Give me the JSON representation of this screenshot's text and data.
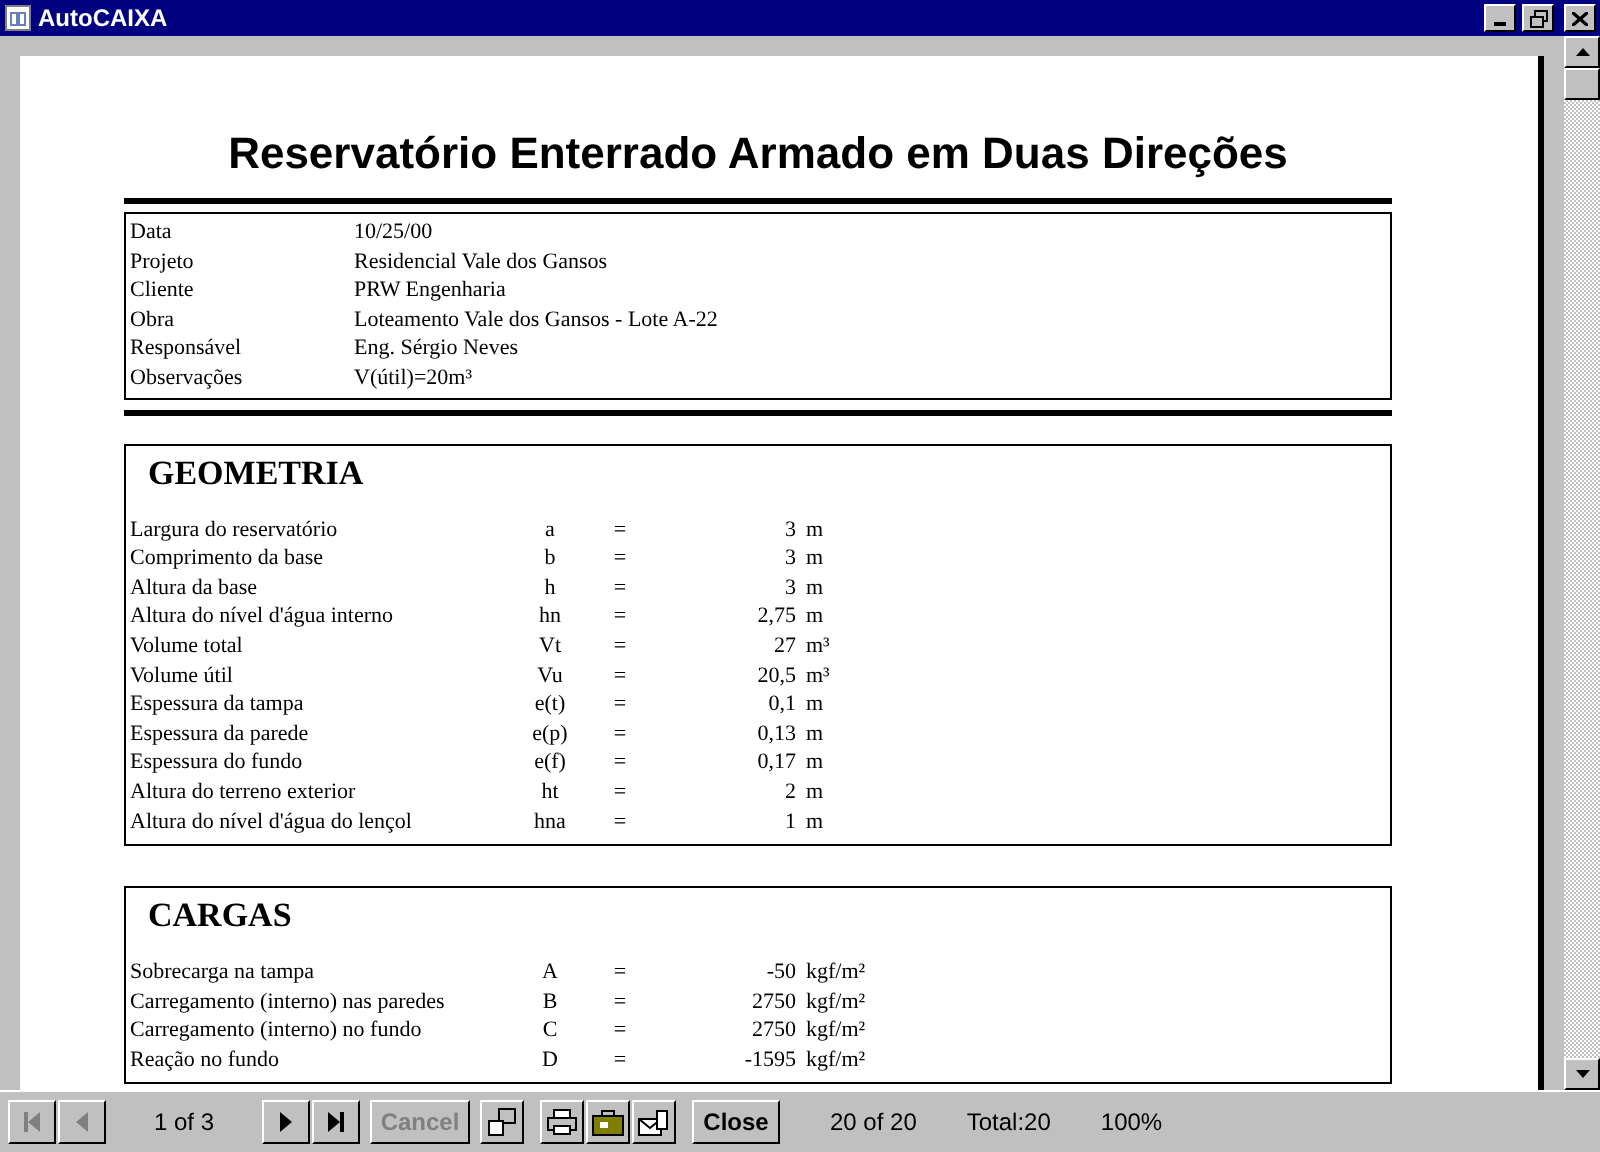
{
  "window": {
    "title": "AutoCAIXA"
  },
  "report": {
    "title": "Reservatório Enterrado Armado em Duas Direções",
    "info": [
      {
        "label": "Data",
        "value": "10/25/00"
      },
      {
        "label": "Projeto",
        "value": "Residencial Vale dos Gansos"
      },
      {
        "label": "Cliente",
        "value": "PRW Engenharia"
      },
      {
        "label": "Obra",
        "value": "Loteamento Vale dos Gansos - Lote A-22"
      },
      {
        "label": "Responsável",
        "value": "Eng. Sérgio Neves"
      },
      {
        "label": "Observações",
        "value": "V(útil)=20m³"
      }
    ],
    "sections": [
      {
        "heading": "GEOMETRIA",
        "rows": [
          {
            "label": "Largura do reservatório",
            "symbol": "a",
            "equals": "=",
            "value": "3",
            "unit": "m"
          },
          {
            "label": "Comprimento da base",
            "symbol": "b",
            "equals": "=",
            "value": "3",
            "unit": "m"
          },
          {
            "label": "Altura da base",
            "symbol": "h",
            "equals": "=",
            "value": "3",
            "unit": "m"
          },
          {
            "label": "Altura do nível d'água interno",
            "symbol": "hn",
            "equals": "=",
            "value": "2,75",
            "unit": "m"
          },
          {
            "label": "Volume total",
            "symbol": "Vt",
            "equals": "=",
            "value": "27",
            "unit": "m³"
          },
          {
            "label": "Volume útil",
            "symbol": "Vu",
            "equals": "=",
            "value": "20,5",
            "unit": "m³"
          },
          {
            "label": "Espessura da tampa",
            "symbol": "e(t)",
            "equals": "=",
            "value": "0,1",
            "unit": "m"
          },
          {
            "label": "Espessura da parede",
            "symbol": "e(p)",
            "equals": "=",
            "value": "0,13",
            "unit": "m"
          },
          {
            "label": "Espessura do fundo",
            "symbol": "e(f)",
            "equals": "=",
            "value": "0,17",
            "unit": "m"
          },
          {
            "label": "Altura do terreno exterior",
            "symbol": "ht",
            "equals": "=",
            "value": "2",
            "unit": "m"
          },
          {
            "label": "Altura do nível d'água do lençol",
            "symbol": "hna",
            "equals": "=",
            "value": "1",
            "unit": "m"
          }
        ]
      },
      {
        "heading": "CARGAS",
        "rows": [
          {
            "label": "Sobrecarga na tampa",
            "symbol": "A",
            "equals": "=",
            "value": "-50",
            "unit": "kgf/m²"
          },
          {
            "label": "Carregamento (interno) nas paredes",
            "symbol": "B",
            "equals": "=",
            "value": "2750",
            "unit": "kgf/m²"
          },
          {
            "label": "Carregamento (interno) no fundo",
            "symbol": "C",
            "equals": "=",
            "value": "2750",
            "unit": "kgf/m²"
          },
          {
            "label": "Reação no fundo",
            "symbol": "D",
            "equals": "=",
            "value": "-1595",
            "unit": "kgf/m²"
          }
        ]
      }
    ]
  },
  "toolbar": {
    "first_disabled": true,
    "prev_disabled": true,
    "page": "1 of 3",
    "cancel": {
      "label": "Cancel",
      "disabled": true
    },
    "close": "Close",
    "records": "20 of 20",
    "total": "Total:20",
    "zoom": "100%"
  }
}
